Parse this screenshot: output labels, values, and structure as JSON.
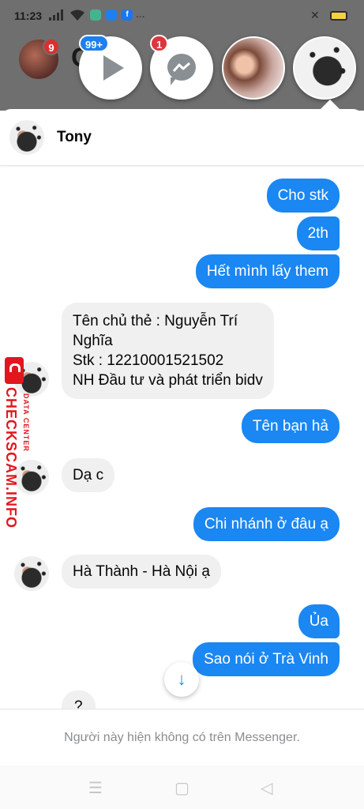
{
  "status_bar": {
    "time": "11:23",
    "icons": [
      "signal-icon",
      "wifi-icon",
      "app-icon",
      "messenger-icon",
      "facebook-icon",
      "more-dots-icon",
      "mute-icon",
      "battery-icon"
    ],
    "more": "..."
  },
  "background_app": {
    "badge": "9",
    "partial_text": "C"
  },
  "chat_heads": [
    {
      "name": "video",
      "badge": "99+"
    },
    {
      "name": "messenger",
      "badge": "1"
    },
    {
      "name": "contact-photo"
    },
    {
      "name": "tony",
      "active": true
    }
  ],
  "header": {
    "title": "Tony"
  },
  "messages": [
    {
      "dir": "out",
      "text": "Cho stk"
    },
    {
      "dir": "out",
      "text": "2th"
    },
    {
      "dir": "out",
      "text": "Hết mình lấy them"
    },
    {
      "dir": "in",
      "lines": [
        "Tên chủ thẻ : Nguyễn Trí",
        "Nghĩa",
        "Stk : 12210001521502",
        "NH Đầu tư và phát triển bidv"
      ]
    },
    {
      "dir": "out",
      "text": "Tên bạn hả"
    },
    {
      "dir": "in",
      "text": "Dạ c"
    },
    {
      "dir": "out",
      "text": "Chi nhánh ở đâu ạ"
    },
    {
      "dir": "in",
      "text": "Hà Thành - Hà Nội ạ"
    },
    {
      "dir": "out",
      "text": "Ủa"
    },
    {
      "dir": "out",
      "text": "Sao nói ở Trà Vinh"
    },
    {
      "dir": "in",
      "text": "?"
    }
  ],
  "footer": {
    "unavailable_text": "Người này hiện không có trên Messenger."
  },
  "watermark": {
    "brand": "CHECKSCAM.INFO",
    "sub": "DATA CENTER"
  },
  "colors": {
    "outgoing": "#1a87f2",
    "incoming": "#f0f0f0",
    "badge_blue": "#1e7ff0",
    "badge_red": "#e0343f"
  }
}
